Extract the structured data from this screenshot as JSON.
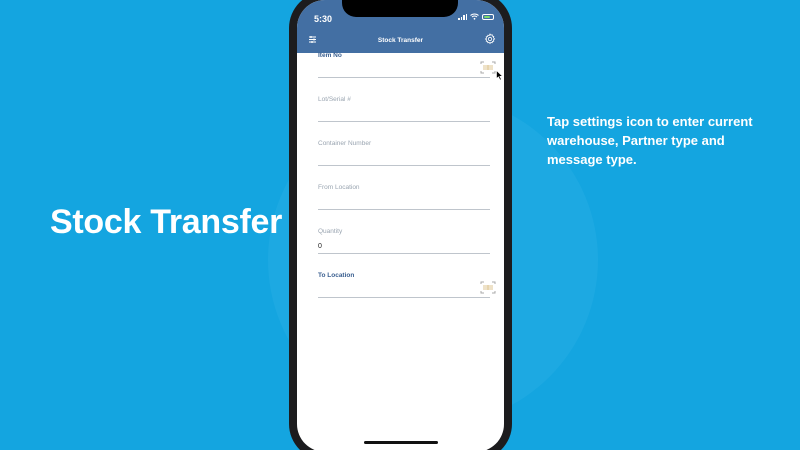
{
  "slide": {
    "title": "Stock Transfer",
    "note": "Tap settings icon to enter current warehouse, Partner type and message type."
  },
  "phone": {
    "status_time": "5:30",
    "nav_title": "Stock Transfer",
    "menu_icon": "menu-icon",
    "settings_icon": "gear-icon",
    "header_color": "#436fa3"
  },
  "form": {
    "item_no": {
      "label": "Item No",
      "value": "",
      "icon": "barcode-scan-icon"
    },
    "lot_serial": {
      "label": "Lot/Serial #",
      "value": ""
    },
    "container_number": {
      "label": "Container Number",
      "value": ""
    },
    "from_location": {
      "label": "From Location",
      "value": ""
    },
    "quantity": {
      "label": "Quantity",
      "value": "0"
    },
    "to_location": {
      "label": "To Location",
      "value": "",
      "icon": "barcode-scan-icon"
    }
  },
  "colors": {
    "background": "#14a5e0",
    "active_label": "#3a5f90",
    "inactive_label": "#9aa5b1"
  }
}
